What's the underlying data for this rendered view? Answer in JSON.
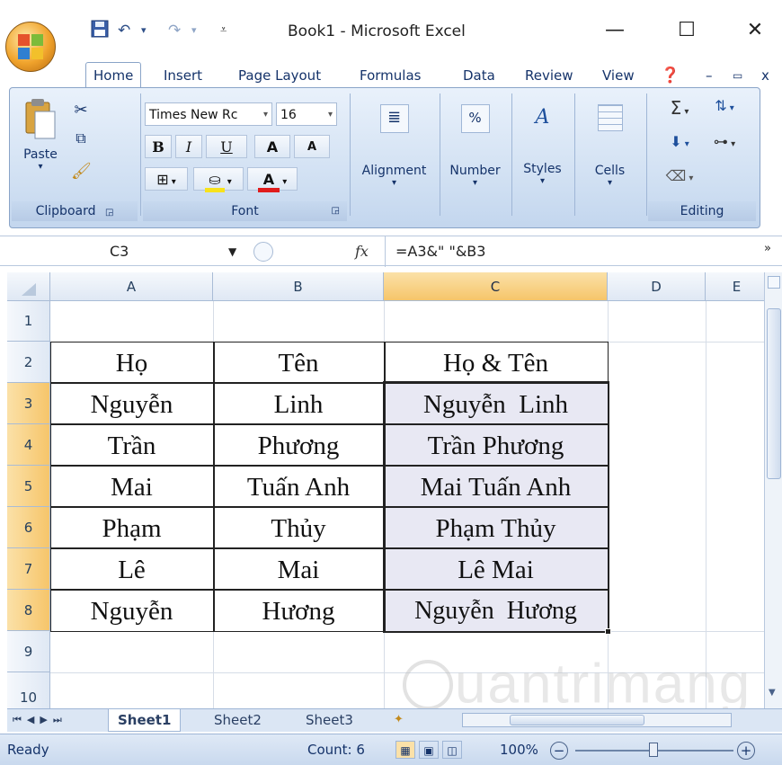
{
  "window": {
    "title": "Book1 - Microsoft Excel",
    "minimize": "—",
    "maximize": "☐",
    "close": "✕"
  },
  "tabs": [
    "Home",
    "Insert",
    "Page Layout",
    "Formulas",
    "Data",
    "Review",
    "View"
  ],
  "ribbon": {
    "clipboard": {
      "paste": "Paste",
      "label": "Clipboard"
    },
    "font": {
      "name": "Times New Rc",
      "size": "16",
      "bold": "B",
      "italic": "I",
      "underline": "U",
      "grow": "A",
      "shrink": "A",
      "label": "Font",
      "color_accent": "#e01c1c",
      "fill_accent": "#f7e21c"
    },
    "alignment": {
      "label": "Alignment"
    },
    "number": {
      "label": "Number",
      "icon_text": "%"
    },
    "styles": {
      "label": "Styles"
    },
    "cells": {
      "label": "Cells"
    },
    "editing": {
      "label": "Editing",
      "sum": "Σ"
    }
  },
  "formula_bar": {
    "name_box": "C3",
    "fx": "fx",
    "formula": "=A3&\" \"&B3"
  },
  "columns": [
    "A",
    "B",
    "C",
    "D",
    "E"
  ],
  "rows": [
    "1",
    "2",
    "3",
    "4",
    "5",
    "6",
    "7",
    "8",
    "9",
    "10"
  ],
  "cells": {
    "A2": "Họ",
    "B2": "Tên",
    "C2": "Họ & Tên",
    "A3": "Nguyễn",
    "B3": "Linh",
    "C3": "Nguyễn  Linh",
    "A4": "Trần",
    "B4": "Phương",
    "C4": "Trần Phương",
    "A5": "Mai",
    "B5": "Tuấn Anh",
    "C5": "Mai Tuấn Anh",
    "A6": "Phạm",
    "B6": "Thủy",
    "C6": "Phạm Thủy",
    "A7": "Lê",
    "B7": "Mai",
    "C7": "Lê Mai",
    "A8": "Nguyễn",
    "B8": "Hương",
    "C8": "Nguyễn  Hương"
  },
  "sheets": [
    "Sheet1",
    "Sheet2",
    "Sheet3"
  ],
  "status": {
    "mode": "Ready",
    "count": "Count: 6",
    "zoom": "100%"
  },
  "watermark": "uantrimang",
  "colors": {
    "selection_header": "#f6c56a",
    "selected_range_fill": "#e8e8f3",
    "ribbon_blue": "#cfdff2"
  }
}
